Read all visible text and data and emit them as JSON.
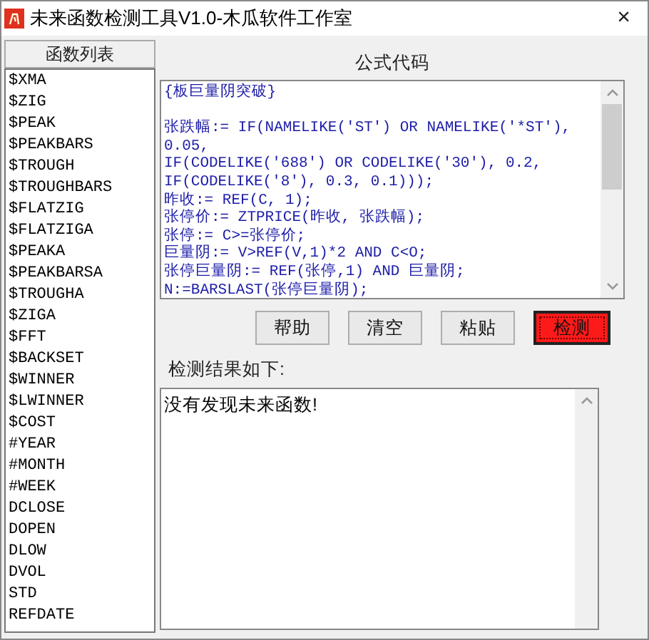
{
  "window": {
    "title": "未来函数检测工具V1.0-木瓜软件工作室",
    "close": "×"
  },
  "function_list": {
    "title": "函数列表",
    "items": [
      "$XMA",
      "$ZIG",
      "$PEAK",
      "$PEAKBARS",
      "$TROUGH",
      "$TROUGHBARS",
      "$FLATZIG",
      "$FLATZIGA",
      "$PEAKA",
      "$PEAKBARSA",
      "$TROUGHA",
      "$ZIGA",
      "$FFT",
      "$BACKSET",
      "$WINNER",
      "$LWINNER",
      "$COST",
      "#YEAR",
      "#MONTH",
      "#WEEK",
      "DCLOSE",
      "DOPEN",
      "DLOW",
      "DVOL",
      "STD",
      "REFDATE"
    ]
  },
  "formula": {
    "title": "公式代码",
    "heading": "{板巨量阴突破}",
    "lines": [
      "张跌幅:= IF(NAMELIKE('ST') OR NAMELIKE('*ST'),",
      "0.05,",
      "IF(CODELIKE('688') OR CODELIKE('30'), 0.2,",
      "IF(CODELIKE('8'), 0.3, 0.1)));",
      "昨收:= REF(C, 1);",
      "张停价:= ZTPRICE(昨收, 张跌幅);",
      "张停:= C>=张停价;",
      "巨量阴:= V>REF(V,1)*2 AND C<O;",
      "张停巨量阴:= REF(张停,1) AND 巨量阴;",
      "N:=BARSLAST(张停巨量阴);"
    ]
  },
  "buttons": [
    {
      "label": "帮助",
      "kind": "normal"
    },
    {
      "label": "清空",
      "kind": "normal"
    },
    {
      "label": "粘贴",
      "kind": "normal"
    },
    {
      "label": "检测",
      "kind": "primary"
    }
  ],
  "result": {
    "label": "检测结果如下:",
    "text": "没有发现未来函数!"
  }
}
